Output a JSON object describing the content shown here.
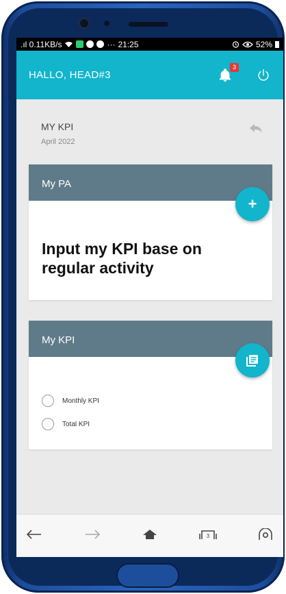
{
  "status_bar": {
    "signal_text": ".ıl 0.11KB/s",
    "more": "···",
    "time": "21:25",
    "battery": "52%"
  },
  "header": {
    "title": "HALLO, HEAD#3",
    "notification_count": "3",
    "accent_color": "#12b5cb"
  },
  "page": {
    "title": "MY KPI",
    "date": "April 2022"
  },
  "pa_card": {
    "title": "My PA",
    "message": "Input my KPI base on regular activity",
    "fab_icon": "plus-icon"
  },
  "kpi_card": {
    "title": "My KPI",
    "fab_icon": "document-list-icon",
    "options": [
      {
        "label": "Monthly KPI"
      },
      {
        "label": "Total KPI"
      }
    ]
  },
  "nav": {
    "icons": [
      "arrow-left-icon",
      "arrow-right-icon",
      "home-icon",
      "tabs-icon",
      "camera-icon"
    ],
    "tab_count": "3"
  }
}
